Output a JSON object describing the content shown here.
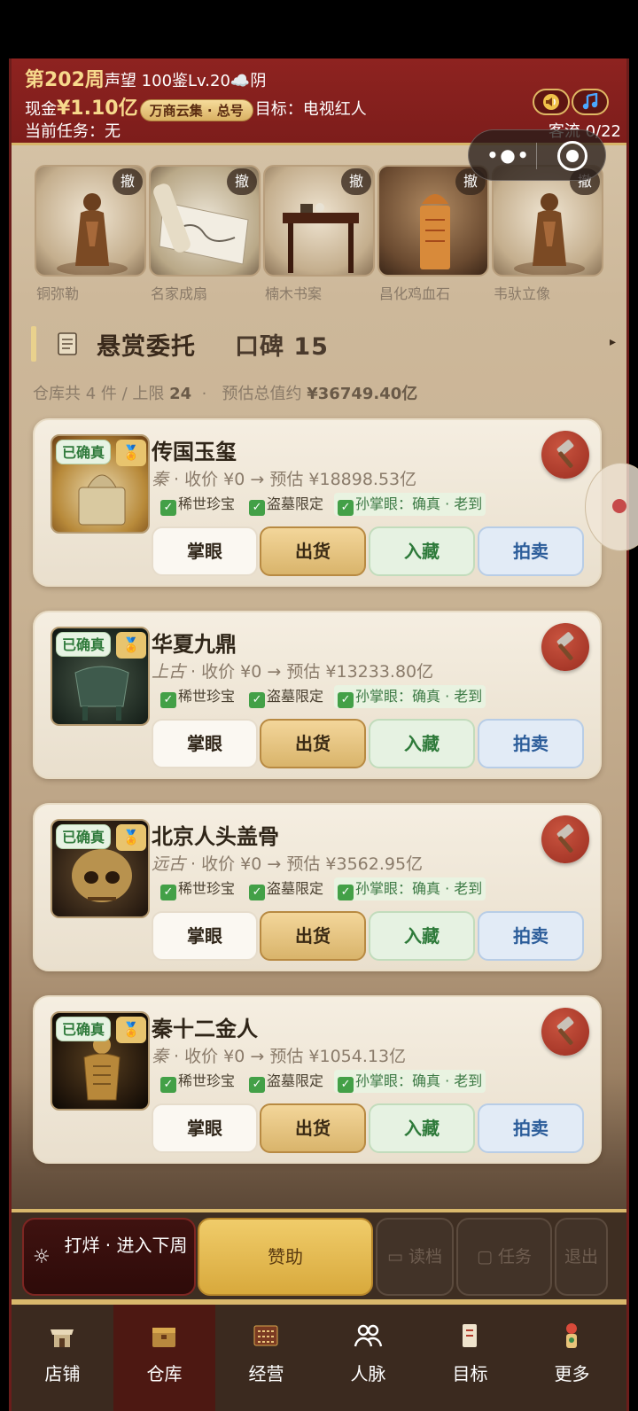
{
  "header": {
    "week": "第202周",
    "status_line": "声望 100鉴Lv.20☁️阴",
    "cash_label": "现金",
    "cash_value": "¥1.10亿",
    "shop_badge": "万商云集 · 总号",
    "goal": "目标：电视红人",
    "task": "当前任务：无",
    "flow": "客流 0/22",
    "sound_icon": "speaker-icon",
    "music_icon": "music-note-icon"
  },
  "shelf": [
    {
      "name": "铜弥勒",
      "cancel": "撤"
    },
    {
      "name": "名家成扇",
      "cancel": "撤"
    },
    {
      "name": "楠木书案",
      "cancel": "撤"
    },
    {
      "name": "昌化鸡血石",
      "cancel": "撤"
    },
    {
      "name": "韦驮立像",
      "cancel": "撤"
    }
  ],
  "section": {
    "title": "悬赏委托",
    "reputation": "口碑 15",
    "arrow": "▸"
  },
  "stats": {
    "prefix": "仓库共 4 件 / 上限 ",
    "limit": "24",
    "mid": "  ·   预估总值约 ",
    "total": "¥36749.40亿"
  },
  "cards": [
    {
      "name": "传国玉玺",
      "era": "秦",
      "info": " · 收价 ¥0 → 预估 ¥18898.53亿",
      "verified": "已确真",
      "medal": "🏅",
      "tags": [
        "稀世珍宝",
        "盗墓限定",
        "孙掌眼：确真 · 老到"
      ],
      "buttons": [
        "掌眼",
        "出货",
        "入藏",
        "拍卖"
      ]
    },
    {
      "name": "华夏九鼎",
      "era": "上古",
      "info": " · 收价 ¥0 → 预估 ¥13233.80亿",
      "verified": "已确真",
      "medal": "🏅",
      "tags": [
        "稀世珍宝",
        "盗墓限定",
        "孙掌眼：确真 · 老到"
      ],
      "buttons": [
        "掌眼",
        "出货",
        "入藏",
        "拍卖"
      ]
    },
    {
      "name": "北京人头盖骨",
      "era": "远古",
      "info": " · 收价 ¥0 → 预估 ¥3562.95亿",
      "verified": "已确真",
      "medal": "🏅",
      "tags": [
        "稀世珍宝",
        "盗墓限定",
        "孙掌眼：确真 · 老到"
      ],
      "buttons": [
        "掌眼",
        "出货",
        "入藏",
        "拍卖"
      ]
    },
    {
      "name": "秦十二金人",
      "era": "秦",
      "info": " · 收价 ¥0 → 预估 ¥1054.13亿",
      "verified": "已确真",
      "medal": "🏅",
      "tags": [
        "稀世珍宝",
        "盗墓限定",
        "孙掌眼：确真 · 老到"
      ],
      "buttons": [
        "掌眼",
        "出货",
        "入藏",
        "拍卖"
      ]
    }
  ],
  "actions": {
    "next_week": "打烊 · 进入下周",
    "sponsor": "赞助",
    "load": "读档",
    "task": "任务",
    "exit": "退出"
  },
  "tabs": [
    {
      "label": "店铺",
      "icon": "shop-icon"
    },
    {
      "label": "仓库",
      "icon": "warehouse-icon",
      "active": true
    },
    {
      "label": "经营",
      "icon": "abacus-icon"
    },
    {
      "label": "人脉",
      "icon": "people-icon"
    },
    {
      "label": "目标",
      "icon": "scroll-icon"
    },
    {
      "label": "更多",
      "icon": "more-icon"
    }
  ],
  "colors": {
    "header_red": "#8e2320",
    "gold": "#d9b86c",
    "accent_green": "#2e7a3a",
    "accent_blue": "#2c5d9a"
  }
}
